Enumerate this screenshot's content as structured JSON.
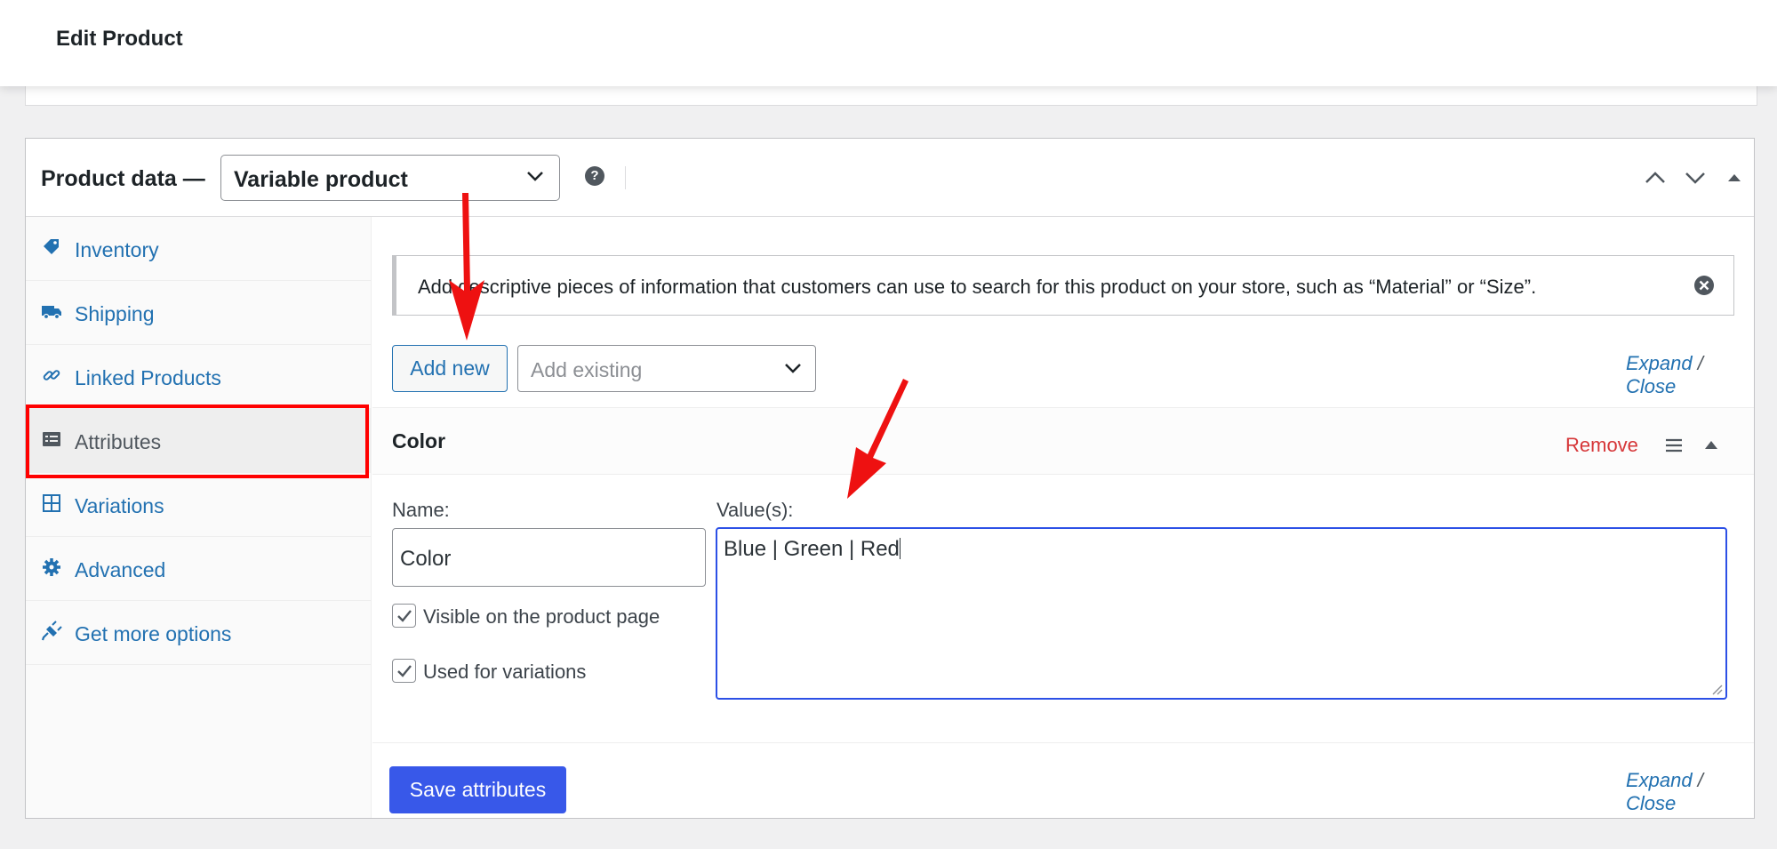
{
  "header": {
    "title": "Edit Product"
  },
  "product_data": {
    "title": "Product data —",
    "type_select": "Variable product",
    "help_icon": "?"
  },
  "tabs": [
    {
      "label": "Inventory",
      "icon": "tag-icon"
    },
    {
      "label": "Shipping",
      "icon": "truck-icon"
    },
    {
      "label": "Linked Products",
      "icon": "link-icon"
    },
    {
      "label": "Attributes",
      "icon": "list-icon",
      "active": true
    },
    {
      "label": "Variations",
      "icon": "grid-icon"
    },
    {
      "label": "Advanced",
      "icon": "gear-icon"
    },
    {
      "label": "Get more options",
      "icon": "plug-icon"
    }
  ],
  "notice": {
    "text": "Add descriptive pieces of information that customers can use to search for this product on your store, such as “Material” or “Size”."
  },
  "toolbar": {
    "add_new_label": "Add new",
    "add_existing_placeholder": "Add existing",
    "expand_label": "Expand",
    "separator": "/",
    "close_label": "Close"
  },
  "attribute": {
    "name": "Color",
    "remove_label": "Remove",
    "name_label": "Name:",
    "name_value": "Color",
    "values_label": "Value(s):",
    "values_value": "Blue | Green | Red",
    "visible_label": "Visible on the product page",
    "visible_checked": true,
    "variations_label": "Used for variations",
    "variations_checked": true
  },
  "footer": {
    "save_label": "Save attributes"
  },
  "colors": {
    "link": "#2271b1",
    "primary_button": "#3858e9",
    "remove": "#d63638",
    "highlight": "#ff0000"
  }
}
